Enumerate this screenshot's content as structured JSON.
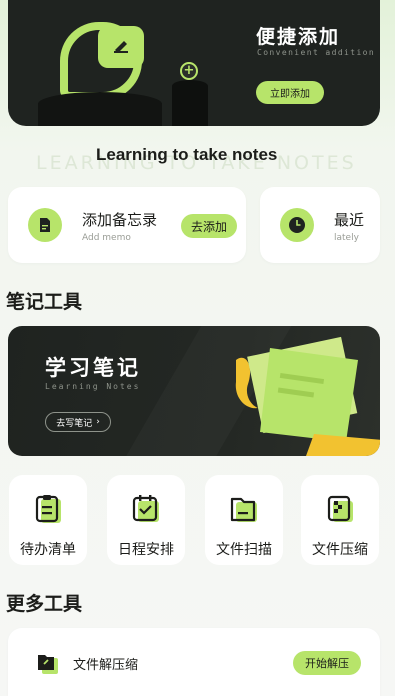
{
  "hero": {
    "title": "便捷添加",
    "subtitle": "Convenient addition",
    "button": "立即添加"
  },
  "section_headline": "Learning to take notes",
  "ghost_text": "LEARNING TO TAKE NOTES",
  "quick_cards": [
    {
      "title": "添加备忘录",
      "subtitle": "Add memo",
      "button": "去添加",
      "icon": "memo-icon"
    },
    {
      "title": "最近",
      "subtitle": "lately",
      "icon": "clock-icon"
    }
  ],
  "notes_tools": {
    "heading": "笔记工具",
    "banner": {
      "title": "学习笔记",
      "subtitle": "Learning Notes",
      "button": "去写笔记"
    },
    "tools": [
      {
        "label": "待办清单",
        "icon": "clipboard-icon"
      },
      {
        "label": "日程安排",
        "icon": "calendar-check-icon"
      },
      {
        "label": "文件扫描",
        "icon": "folder-icon"
      },
      {
        "label": "文件压缩",
        "icon": "compress-file-icon"
      }
    ]
  },
  "more_tools": {
    "heading": "更多工具",
    "items": [
      {
        "label": "文件解压缩",
        "button": "开始解压",
        "icon": "unzip-folder-icon"
      }
    ]
  },
  "colors": {
    "accent": "#b7e46a",
    "dark": "#1f2320",
    "background": "#f6f7f5"
  }
}
